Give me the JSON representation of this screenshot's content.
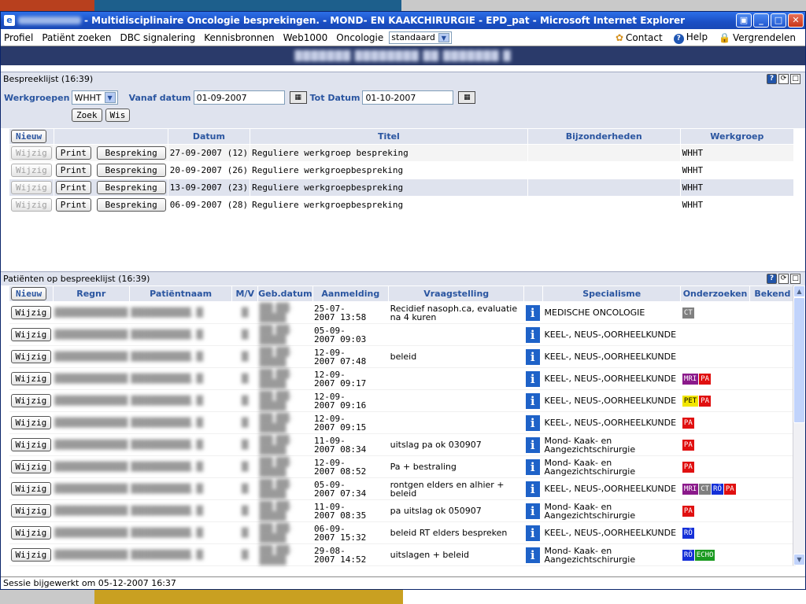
{
  "window": {
    "title": "- Multidisciplinaire Oncologie besprekingen. - MOND- EN KAAKCHIRURGIE - EPD_pat - Microsoft Internet Explorer"
  },
  "menu": {
    "items": [
      "Profiel",
      "Patiënt zoeken",
      "DBC signalering",
      "Kennisbronnen",
      "Web1000",
      "Oncologie"
    ],
    "profile_select": "standaard",
    "contact": "Contact",
    "help": "Help",
    "lock": "Vergrendelen"
  },
  "meetings_panel": {
    "title": "Bespreeklijst (16:39)",
    "filter": {
      "werkgroepen_label": "Werkgroepen",
      "werkgroepen_value": "WHHT",
      "vanaf_label": "Vanaf datum",
      "vanaf_value": "01-09-2007",
      "tot_label": "Tot Datum",
      "tot_value": "01-10-2007",
      "search_button": "Zoek",
      "clear_button": "Wis"
    },
    "new_button": "Nieuw",
    "columns": [
      "Datum",
      "Titel",
      "Bijzonderheden",
      "Werkgroep"
    ],
    "row_buttons": {
      "edit": "Wijzig",
      "print": "Print",
      "meeting": "Bespreking"
    },
    "rows": [
      {
        "datum": "27-09-2007 (12)",
        "titel": "Reguliere werkgroep bespreking",
        "bijzonderheden": "",
        "werkgroep": "WHHT"
      },
      {
        "datum": "20-09-2007 (26)",
        "titel": "Reguliere werkgroepbespreking",
        "bijzonderheden": "",
        "werkgroep": "WHHT"
      },
      {
        "datum": "13-09-2007 (23)",
        "titel": "Reguliere werkgroepbespreking",
        "bijzonderheden": "",
        "werkgroep": "WHHT"
      },
      {
        "datum": "06-09-2007 (28)",
        "titel": "Reguliere werkgroepbespreking",
        "bijzonderheden": "",
        "werkgroep": "WHHT"
      }
    ]
  },
  "patients_panel": {
    "title": "Patiënten op bespreeklijst (16:39)",
    "new_button": "Nieuw",
    "edit_button": "Wijzig",
    "columns": [
      "Regnr",
      "Patiëntnaam",
      "M/V",
      "Geb.datum",
      "Aanmelding",
      "Vraagstelling",
      "",
      "Specialisme",
      "Onderzoeken",
      "Bekend"
    ],
    "tag_colors": {
      "CT": "#808080",
      "MRI": "#8b1a8b",
      "PA": "#e01010",
      "PET": "#f2e600",
      "RÖ": "#1530d8",
      "ECHO": "#1a9a20"
    },
    "rows": [
      {
        "aanmelding_1": "25-07-",
        "aanmelding_2": "2007 13:58",
        "vraagstelling": "Recidief nasoph.ca, evaluatie na 4 kuren",
        "specialisme": "MEDISCHE ONCOLOGIE",
        "onderzoeken": [
          "CT"
        ]
      },
      {
        "aanmelding_1": "05-09-",
        "aanmelding_2": "2007 09:03",
        "vraagstelling": "",
        "specialisme": "KEEL-, NEUS-,OORHEELKUNDE",
        "onderzoeken": []
      },
      {
        "aanmelding_1": "12-09-",
        "aanmelding_2": "2007 07:48",
        "vraagstelling": "beleid",
        "specialisme": "KEEL-, NEUS-,OORHEELKUNDE",
        "onderzoeken": []
      },
      {
        "aanmelding_1": "12-09-",
        "aanmelding_2": "2007 09:17",
        "vraagstelling": "",
        "specialisme": "KEEL-, NEUS-,OORHEELKUNDE",
        "onderzoeken": [
          "MRI",
          "PA"
        ]
      },
      {
        "aanmelding_1": "12-09-",
        "aanmelding_2": "2007 09:16",
        "vraagstelling": "",
        "specialisme": "KEEL-, NEUS-,OORHEELKUNDE",
        "onderzoeken": [
          "PET",
          "PA"
        ]
      },
      {
        "aanmelding_1": "12-09-",
        "aanmelding_2": "2007 09:15",
        "vraagstelling": "",
        "specialisme": "KEEL-, NEUS-,OORHEELKUNDE",
        "onderzoeken": [
          "PA"
        ]
      },
      {
        "aanmelding_1": "11-09-",
        "aanmelding_2": "2007 08:34",
        "vraagstelling": "uitslag pa ok 030907",
        "specialisme": "Mond- Kaak- en Aangezichtschirurgie",
        "onderzoeken": [
          "PA"
        ]
      },
      {
        "aanmelding_1": "12-09-",
        "aanmelding_2": "2007 08:52",
        "vraagstelling": "Pa + bestraling",
        "specialisme": "Mond- Kaak- en Aangezichtschirurgie",
        "onderzoeken": [
          "PA"
        ]
      },
      {
        "aanmelding_1": "05-09-",
        "aanmelding_2": "2007 07:34",
        "vraagstelling": "rontgen elders en alhier + beleid",
        "specialisme": "KEEL-, NEUS-,OORHEELKUNDE",
        "onderzoeken": [
          "MRI",
          "CT",
          "RÖ",
          "PA"
        ]
      },
      {
        "aanmelding_1": "11-09-",
        "aanmelding_2": "2007 08:35",
        "vraagstelling": "pa uitslag ok 050907",
        "specialisme": "Mond- Kaak- en Aangezichtschirurgie",
        "onderzoeken": [
          "PA"
        ]
      },
      {
        "aanmelding_1": "06-09-",
        "aanmelding_2": "2007 15:32",
        "vraagstelling": "beleid RT elders bespreken",
        "specialisme": "KEEL-, NEUS-,OORHEELKUNDE",
        "onderzoeken": [
          "RÖ"
        ]
      },
      {
        "aanmelding_1": "29-08-",
        "aanmelding_2": "2007 14:52",
        "vraagstelling": "uitslagen + beleid",
        "specialisme": "Mond- Kaak- en Aangezichtschirurgie",
        "onderzoeken": [
          "RÖ",
          "ECHO"
        ]
      }
    ]
  },
  "status": {
    "text": "Sessie bijgewerkt om 05-12-2007 16:37"
  }
}
